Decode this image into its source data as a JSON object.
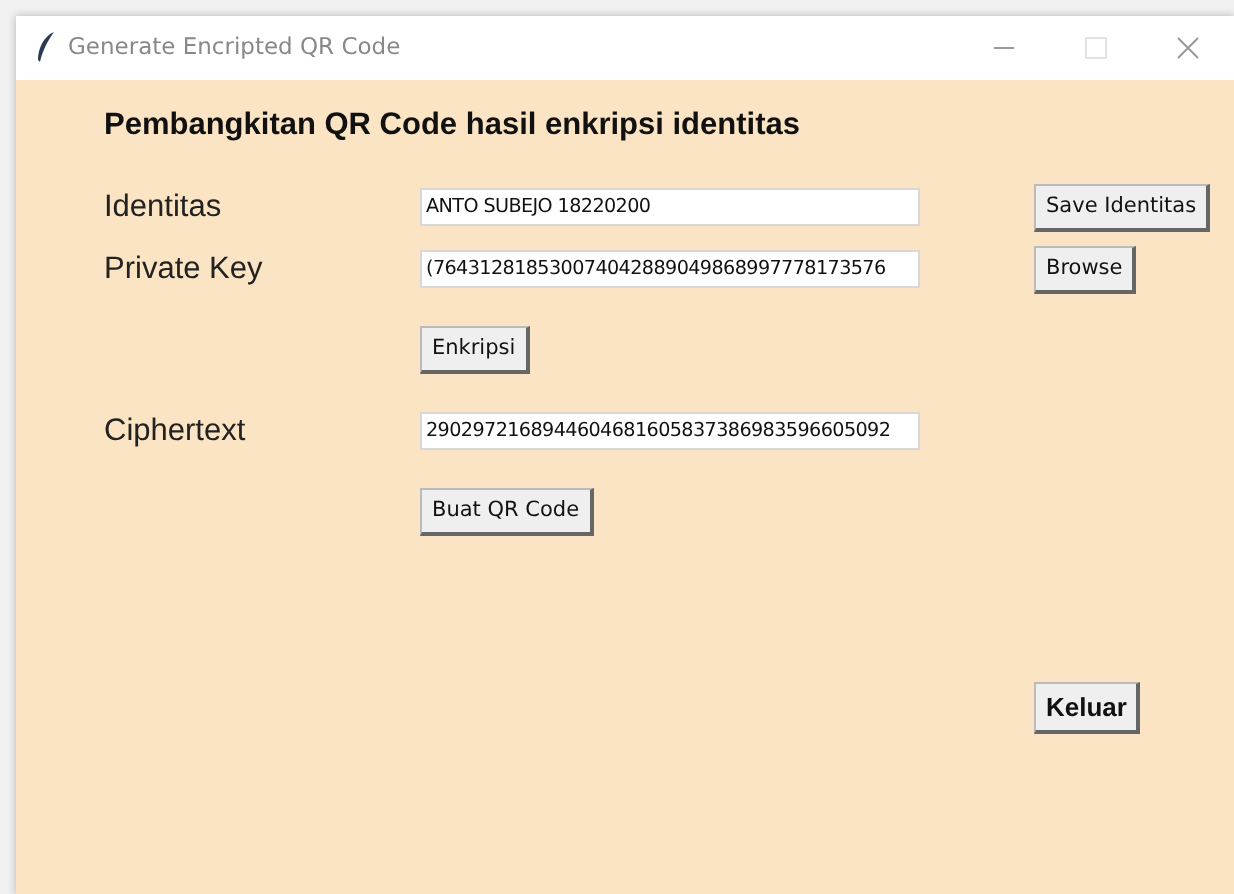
{
  "window": {
    "title": "Generate Encripted QR Code"
  },
  "heading": "Pembangkitan QR Code hasil enkripsi identitas",
  "rows": [
    {
      "kind": "field",
      "label": "Identitas",
      "value": "ANTO SUBEJO 18220200",
      "button": "Save Identitas"
    },
    {
      "kind": "field",
      "label": "Private Key",
      "value": "(764312818530074042889049868997778173576",
      "button": "Browse"
    },
    {
      "kind": "button",
      "button": "Enkripsi"
    },
    {
      "kind": "field",
      "label": "Ciphertext",
      "value": "2902972168944604681605837386983596605092"
    },
    {
      "kind": "button",
      "button": "Buat QR Code"
    }
  ],
  "exit_button": "Keluar"
}
